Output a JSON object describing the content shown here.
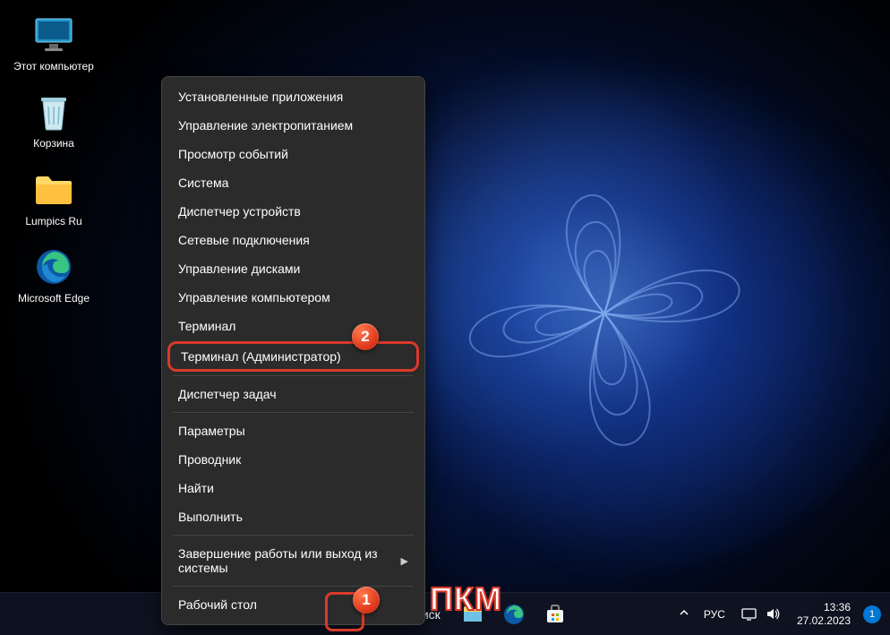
{
  "desktop": {
    "icons": [
      {
        "label": "Этот компьютер",
        "type": "computer"
      },
      {
        "label": "Корзина",
        "type": "bin"
      },
      {
        "label": "Lumpics Ru",
        "type": "folder"
      },
      {
        "label": "Microsoft Edge",
        "type": "edge"
      }
    ]
  },
  "context_menu": {
    "items": [
      {
        "label": "Установленные приложения"
      },
      {
        "label": "Управление электропитанием"
      },
      {
        "label": "Просмотр событий"
      },
      {
        "label": "Система"
      },
      {
        "label": "Диспетчер устройств"
      },
      {
        "label": "Сетевые подключения"
      },
      {
        "label": "Управление дисками"
      },
      {
        "label": "Управление компьютером"
      },
      {
        "label": "Терминал"
      },
      {
        "label": "Терминал (Администратор)",
        "highlighted": true
      },
      {
        "sep": true
      },
      {
        "label": "Диспетчер задач"
      },
      {
        "sep": true
      },
      {
        "label": "Параметры"
      },
      {
        "label": "Проводник"
      },
      {
        "label": "Найти"
      },
      {
        "label": "Выполнить"
      },
      {
        "sep": true
      },
      {
        "label": "Завершение работы или выход из системы",
        "submenu": true
      },
      {
        "sep": true
      },
      {
        "label": "Рабочий стол"
      }
    ]
  },
  "annotations": {
    "badge1": "1",
    "badge2": "2",
    "pkm": "ПКМ"
  },
  "taskbar": {
    "search_label": "Поиск",
    "language": "РУС",
    "time": "13:36",
    "date": "27.02.2023",
    "notif_count": "1"
  }
}
